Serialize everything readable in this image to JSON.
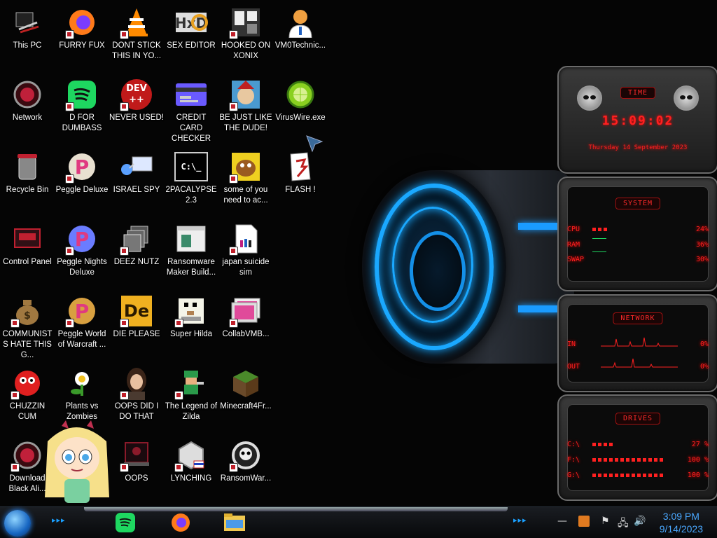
{
  "desktop": {
    "icons": [
      {
        "label": "This PC"
      },
      {
        "label": "FURRY FUX"
      },
      {
        "label": "DONT STICK THIS IN YO..."
      },
      {
        "label": "SEX EDITOR"
      },
      {
        "label": "HOOKED ON XONIX"
      },
      {
        "label": "VM0Technic..."
      },
      {
        "label": "Network"
      },
      {
        "label": "D FOR DUMBASS"
      },
      {
        "label": "NEVER USED!"
      },
      {
        "label": "CREDIT CARD CHECKER"
      },
      {
        "label": "BE JUST LIKE THE DUDE!"
      },
      {
        "label": "VirusWire.exe"
      },
      {
        "label": "Recycle Bin"
      },
      {
        "label": "Peggle Deluxe"
      },
      {
        "label": "ISRAEL SPY"
      },
      {
        "label": "2PACALYPSE 2.3"
      },
      {
        "label": "some of you need to ac..."
      },
      {
        "label": "FLASH !"
      },
      {
        "label": "Control Panel"
      },
      {
        "label": "Peggle Nights Deluxe"
      },
      {
        "label": "DEEZ NUTZ"
      },
      {
        "label": "Ransomware Maker Build..."
      },
      {
        "label": "japan suicide sim"
      },
      {
        "label": "COMMUNISTS HATE THIS G..."
      },
      {
        "label": "Peggle World of Warcraft ..."
      },
      {
        "label": "DIE PLEASE"
      },
      {
        "label": "Super Hilda"
      },
      {
        "label": "CollabVMB..."
      },
      {
        "label": "CHUZZIN CUM"
      },
      {
        "label": "Plants vs Zombies"
      },
      {
        "label": "OOPS DID I DO THAT"
      },
      {
        "label": "The Legend of Zilda"
      },
      {
        "label": "Minecraft4Fr..."
      },
      {
        "label": "Download Black Ali..."
      },
      {
        "label": "OOPS"
      },
      {
        "label": "LYNCHING"
      },
      {
        "label": "RansomWar..."
      }
    ],
    "dev_badge": "DEV",
    "dev_badge2": "++",
    "die_badge": "De",
    "cmd_text": "C:\\_"
  },
  "gadgets": {
    "time": {
      "title": "TIME",
      "clock": "15:09:02",
      "date": "Thursday 14 September 2023"
    },
    "system": {
      "title": "SYSTEM",
      "rows": [
        {
          "key": "CPU",
          "value": "24%",
          "level": 0.24
        },
        {
          "key": "RAM",
          "value": "36%",
          "level": 0.36
        },
        {
          "key": "SWAP",
          "value": "30%",
          "level": 0.3
        }
      ]
    },
    "network": {
      "title": "NETWORK",
      "rows": [
        {
          "key": "IN",
          "value": "0%"
        },
        {
          "key": "OUT",
          "value": "0%"
        }
      ]
    },
    "drives": {
      "title": "DRIVES",
      "rows": [
        {
          "key": "C:\\",
          "value": "27 %",
          "level": 0.27
        },
        {
          "key": "F:\\",
          "value": "100 %",
          "level": 1.0
        },
        {
          "key": "G:\\",
          "value": "100 %",
          "level": 1.0
        }
      ]
    }
  },
  "taskbar": {
    "clock_time": "3:09 PM",
    "clock_date": "9/14/2023",
    "chevrons_left": "▸▸▸",
    "chevrons_right": "▸▸▸"
  },
  "colors": {
    "accent_blue": "#1aa8ff",
    "gadget_red": "#ff2020"
  }
}
